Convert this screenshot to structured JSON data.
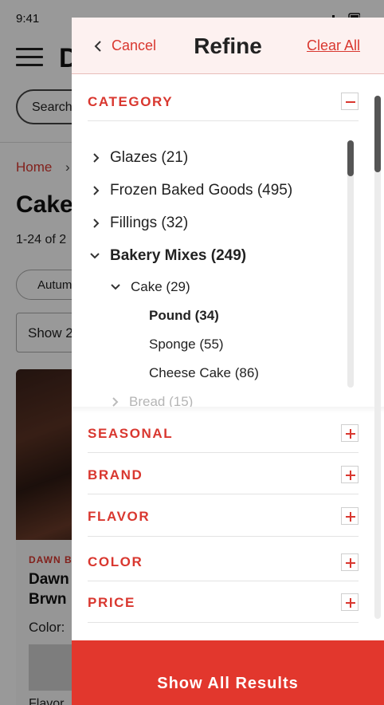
{
  "status_bar": {
    "time": "9:41"
  },
  "background_page": {
    "brand_partial": "D",
    "search_placeholder": "Search",
    "breadcrumb": "Home",
    "breadcrumb_arrow": "›",
    "title_partial": "Cake",
    "results_partial": "1-24 of 2",
    "chip_label": "Autum",
    "show_partial": "Show 2",
    "product": {
      "brand": "DAWN B",
      "name_line1": "Dawn",
      "name_line2": "Brwn",
      "color_label": "Color:",
      "flavor_label": "Flavor"
    }
  },
  "drawer": {
    "cancel_label": "Cancel",
    "title": "Refine",
    "clear_all_label": "Clear All",
    "category": {
      "label": "CATEGORY",
      "items": [
        {
          "label": "Glazes (21)",
          "state": "collapsed"
        },
        {
          "label": "Frozen Baked Goods (495)",
          "state": "collapsed"
        },
        {
          "label": "Fillings (32)",
          "state": "collapsed"
        },
        {
          "label": "Bakery Mixes (249)",
          "state": "expanded"
        },
        {
          "label": "Cake (29)",
          "state": "expanded"
        },
        {
          "label": "Pound (34)",
          "state": "selected"
        },
        {
          "label": "Sponge (55)",
          "state": "leaf"
        },
        {
          "label": "Cheese Cake (86)",
          "state": "leaf"
        },
        {
          "label": "Bread (15)",
          "state": "collapsed"
        }
      ]
    },
    "sections": [
      {
        "label": "SEASONAL"
      },
      {
        "label": "BRAND"
      },
      {
        "label": "FLAVOR"
      },
      {
        "label": "COLOR"
      },
      {
        "label": "PRICE"
      }
    ],
    "show_all_label": "Show All Results"
  },
  "colors": {
    "accent": "#d9372f",
    "button": "#e2372d",
    "header_bg": "#fdf1f0"
  }
}
